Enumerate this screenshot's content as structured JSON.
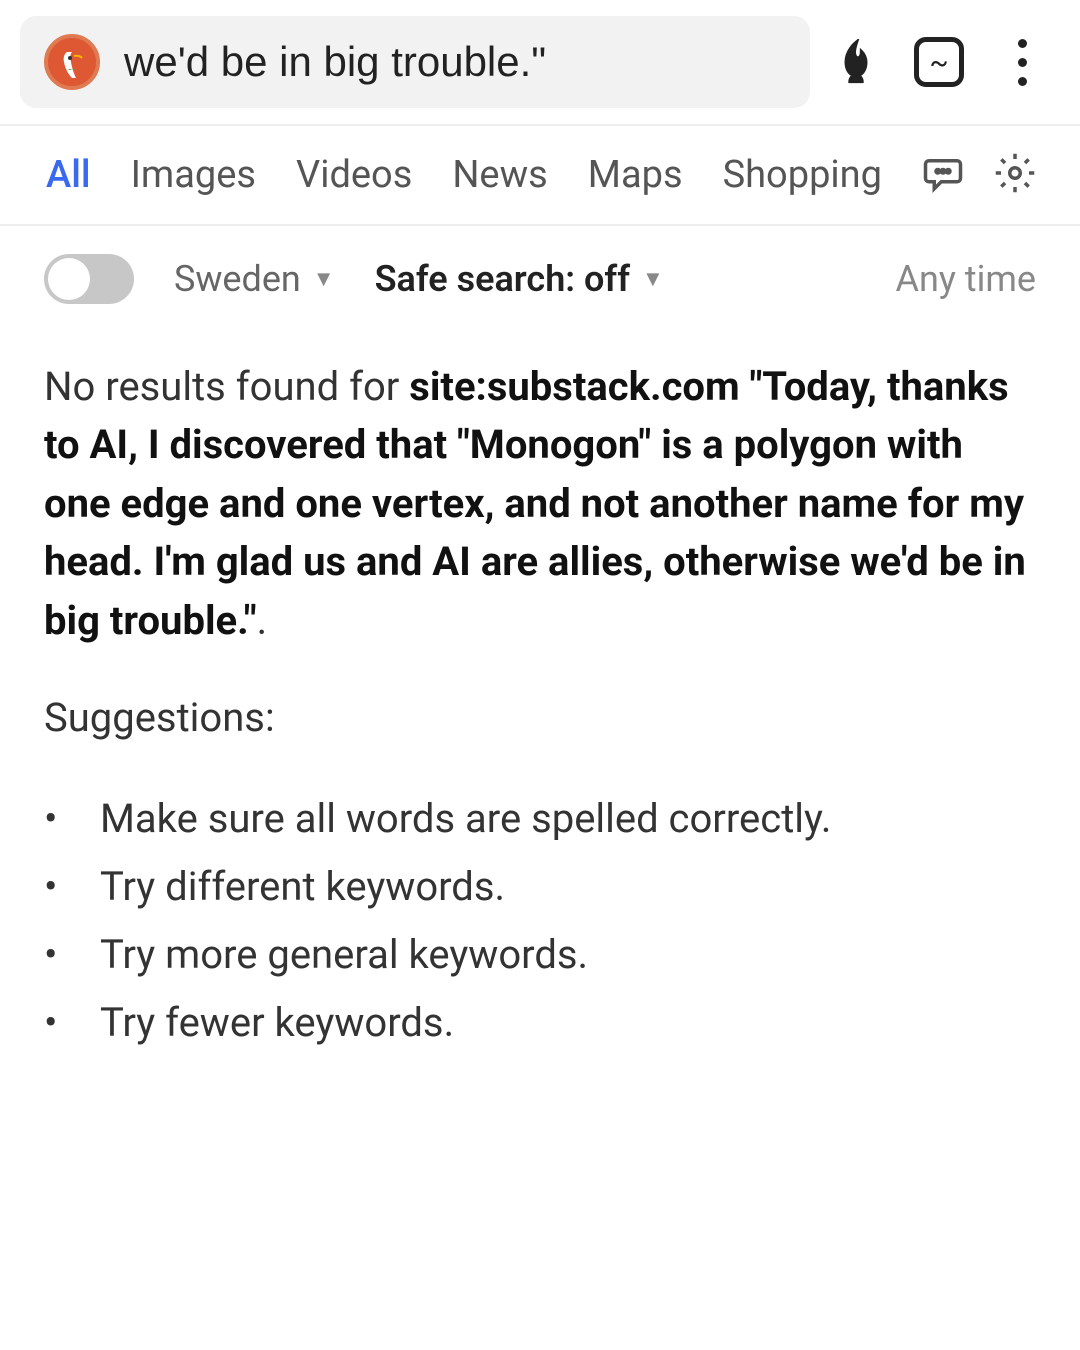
{
  "header": {
    "search_value": "we'd be in big trouble.\"",
    "tabs_indicator": "~"
  },
  "tabs": [
    {
      "label": "All",
      "active": true
    },
    {
      "label": "Images",
      "active": false
    },
    {
      "label": "Videos",
      "active": false
    },
    {
      "label": "News",
      "active": false
    },
    {
      "label": "Maps",
      "active": false
    },
    {
      "label": "Shopping",
      "active": false
    }
  ],
  "filters": {
    "region": "Sweden",
    "safe_search": "Safe search: off",
    "time": "Any time"
  },
  "main": {
    "no_results_prefix": "No results found for ",
    "query_full": "site:substack.com \"Today, thanks to AI, I discovered that \"Monogon\" is a polygon with one edge and one vertex, and not another name for my head. I'm glad us and AI are allies, otherwise we'd be in big trouble.\"",
    "no_results_suffix": ".",
    "suggestions_title": "Suggestions:",
    "suggestions": [
      "Make sure all words are spelled correctly.",
      "Try different keywords.",
      "Try more general keywords.",
      "Try fewer keywords."
    ]
  }
}
